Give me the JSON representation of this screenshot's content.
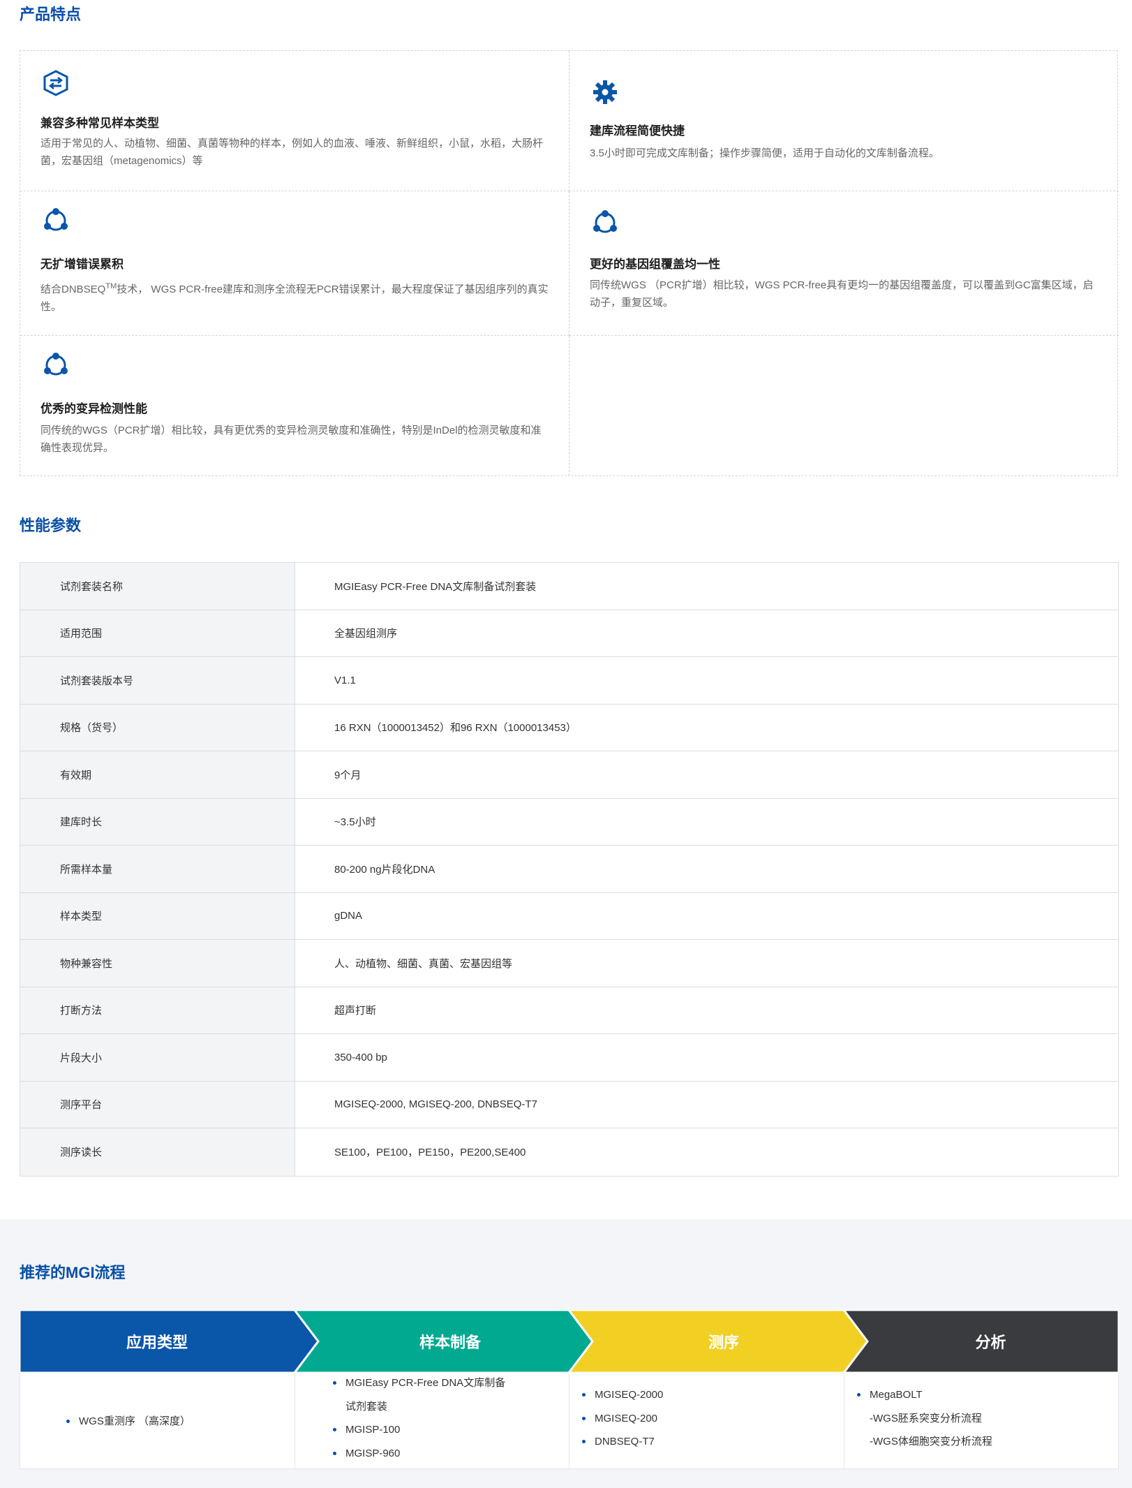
{
  "sections": {
    "features_title": "产品特点",
    "specs_title": "性能参数",
    "workflow_title": "推荐的MGI流程"
  },
  "features": [
    {
      "icon": "compatibility-icon",
      "title": "兼容多种常见样本类型",
      "desc": "适用于常见的人、动植物、细菌、真菌等物种的样本，例如人的血液、唾液、新鲜组织，小鼠，水稻，大肠杆菌，宏基因组（metagenomics）等"
    },
    {
      "icon": "gear-icon",
      "title": "建库流程简便快捷",
      "desc": "3.5小时即可完成文库制备；操作步骤简便，适用于自动化的文库制备流程。"
    },
    {
      "icon": "cycle-icon",
      "title": "无扩增错误累积",
      "desc_pre": "结合DNBSEQ",
      "desc_sup": "TM",
      "desc_post": "技术， WGS PCR-free建库和测序全流程无PCR错误累计，最大程度保证了基因组序列的真实性。"
    },
    {
      "icon": "cycle-icon",
      "title": "更好的基因组覆盖均一性",
      "desc": "同传统WGS （PCR扩增）相比较，WGS PCR-free具有更均一的基因组覆盖度，可以覆盖到GC富集区域，启动子，重复区域。"
    },
    {
      "icon": "cycle-icon",
      "title": "优秀的变异检测性能",
      "desc": "同传统的WGS（PCR扩增）相比较，具有更优秀的变异检测灵敏度和准确性，特别是InDel的检测灵敏度和准确性表现优异。"
    }
  ],
  "specs": [
    {
      "key": "试剂套装名称",
      "value": "MGIEasy PCR-Free DNA文库制备试剂套装"
    },
    {
      "key": "适用范围",
      "value": "全基因组测序"
    },
    {
      "key": "试剂套装版本号",
      "value": "V1.1"
    },
    {
      "key": "规格（货号）",
      "value": "16 RXN（1000013452）和96 RXN（1000013453）"
    },
    {
      "key": "有效期",
      "value": "9个月"
    },
    {
      "key": "建库时长",
      "value": "~3.5小时"
    },
    {
      "key": "所需样本量",
      "value": "80-200 ng片段化DNA"
    },
    {
      "key": "样本类型",
      "value": "gDNA"
    },
    {
      "key": "物种兼容性",
      "value": "人、动植物、细菌、真菌、宏基因组等"
    },
    {
      "key": "打断方法",
      "value": "超声打断"
    },
    {
      "key": "片段大小",
      "value": "350-400 bp"
    },
    {
      "key": "测序平台",
      "value": "MGISEQ-2000, MGISEQ-200, DNBSEQ-T7"
    },
    {
      "key": "测序读长",
      "value": "SE100，PE100，PE150，PE200,SE400"
    }
  ],
  "workflow": {
    "steps": [
      {
        "label": "应用类型",
        "color": "#0a56a8"
      },
      {
        "label": "样本制备",
        "color": "#00a98f"
      },
      {
        "label": "测序",
        "color": "#f2cf23"
      },
      {
        "label": "分析",
        "color": "#3a3b3f"
      }
    ],
    "app": [
      "WGS重测序 （高深度）"
    ],
    "prep": [
      "MGIEasy PCR-Free DNA文库制备",
      "试剂套装",
      "MGISP-100",
      "MGISP-960"
    ],
    "seq": [
      "MGISEQ-2000",
      "MGISEQ-200",
      "DNBSEQ-T7"
    ],
    "analysis": [
      "MegaBOLT",
      "-WGS胚系突变分析流程",
      "-WGS体细胞突变分析流程"
    ]
  }
}
